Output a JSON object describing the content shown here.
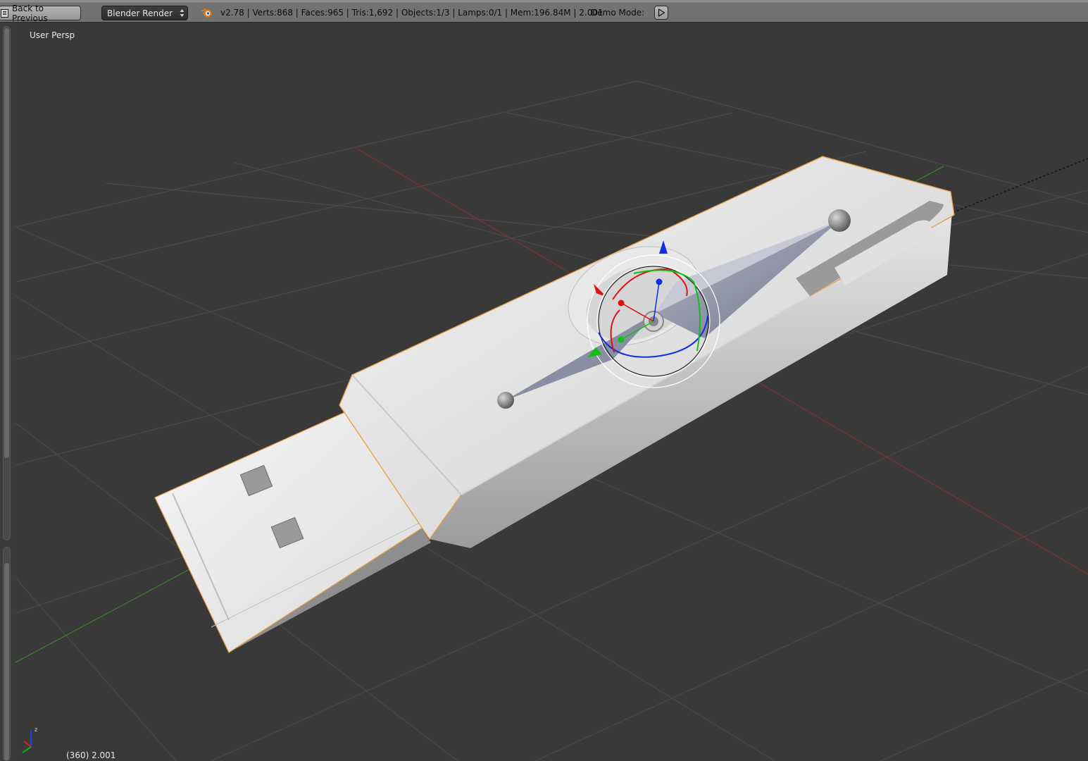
{
  "header": {
    "back_label": "Back to Previous",
    "render_engine": "Blender Render",
    "stats": "v2.78 | Verts:868 | Faces:965 | Tris:1,692 | Objects:1/3 | Lamps:0/1 | Mem:196.84M | 2.001",
    "demo_mode_label": "Demo Mode:"
  },
  "viewport": {
    "view_name": "User Persp",
    "frame_info": "(360) 2.001",
    "axis_labels": {
      "z": "z"
    }
  },
  "icons": {
    "back": "back-to-previous-icon",
    "engine_arrows": "updown-arrows-icon",
    "logo": "blender-logo-icon",
    "play": "play-icon",
    "axis": "axis-orientation-icon"
  },
  "colors": {
    "background": "#393939",
    "grid": "#4a4a4a",
    "x_axis": "#8a2f2f",
    "y_axis": "#3f8a2f",
    "selection_outline": "#e8a040",
    "gizmo_x": "#e01010",
    "gizmo_y": "#10c010",
    "gizmo_z": "#1030e0"
  }
}
